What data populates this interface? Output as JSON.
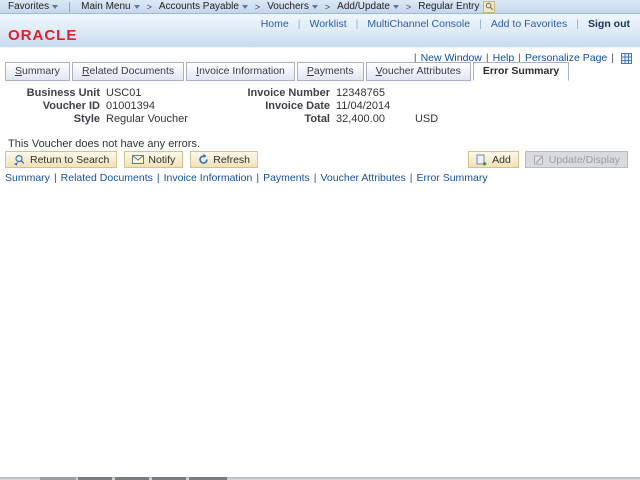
{
  "topbar": {
    "favorites_label": "Favorites",
    "separator": ">",
    "menu_items": [
      {
        "label": "Main Menu"
      },
      {
        "label": "Accounts Payable"
      },
      {
        "label": "Vouchers"
      },
      {
        "label": "Add/Update"
      },
      {
        "label": "Regular Entry"
      }
    ]
  },
  "header": {
    "logo_text": "ORACLE",
    "links": [
      {
        "label": "Home"
      },
      {
        "label": "Worklist"
      },
      {
        "label": "MultiChannel Console"
      },
      {
        "label": "Add to Favorites"
      }
    ],
    "sign_out_label": "Sign out"
  },
  "page_actions": {
    "links": [
      {
        "label": "New Window"
      },
      {
        "label": "Help"
      },
      {
        "label": "Personalize Page"
      }
    ]
  },
  "tabs": [
    {
      "label": "Summary",
      "active": false
    },
    {
      "label": "Related Documents",
      "active": false
    },
    {
      "label": "Invoice Information",
      "active": false
    },
    {
      "label": "Payments",
      "active": false
    },
    {
      "label": "Voucher Attributes",
      "active": false
    },
    {
      "label": "Error Summary",
      "active": true
    }
  ],
  "voucher": {
    "left_fields": [
      {
        "label": "Business Unit",
        "value": "USC01"
      },
      {
        "label": "Voucher ID",
        "value": "01001394"
      },
      {
        "label": "Style",
        "value": "Regular Voucher"
      }
    ],
    "right_fields": [
      {
        "label": "Invoice Number",
        "value": "12348765"
      },
      {
        "label": "Invoice Date",
        "value": "11/04/2014"
      },
      {
        "label": "Total",
        "value": "32,400.00",
        "currency": "USD"
      }
    ],
    "message": "This Voucher does not have any errors."
  },
  "toolbar": {
    "return_to_search_label": "Return to Search",
    "notify_label": "Notify",
    "refresh_label": "Refresh",
    "add_label": "Add",
    "update_display_label": "Update/Display"
  },
  "footer_links": [
    {
      "label": "Summary"
    },
    {
      "label": "Related Documents"
    },
    {
      "label": "Invoice Information"
    },
    {
      "label": "Payments"
    },
    {
      "label": "Voucher Attributes"
    },
    {
      "label": "Error Summary"
    }
  ],
  "separators": {
    "pipe": "|"
  },
  "icons": {
    "lookup": "magnifier",
    "personalize": "grid",
    "return": "magnifier-arrow",
    "notify": "envelope",
    "refresh": "circular-arrow",
    "add": "page-plus",
    "update": "page-pencil"
  },
  "colors": {
    "brand_red": "#e21e26",
    "link_blue": "#14519e",
    "header_blue": "#c8dbef",
    "button_beige": "#f1e1b6",
    "topbar_blue": "#c3d7ec"
  }
}
